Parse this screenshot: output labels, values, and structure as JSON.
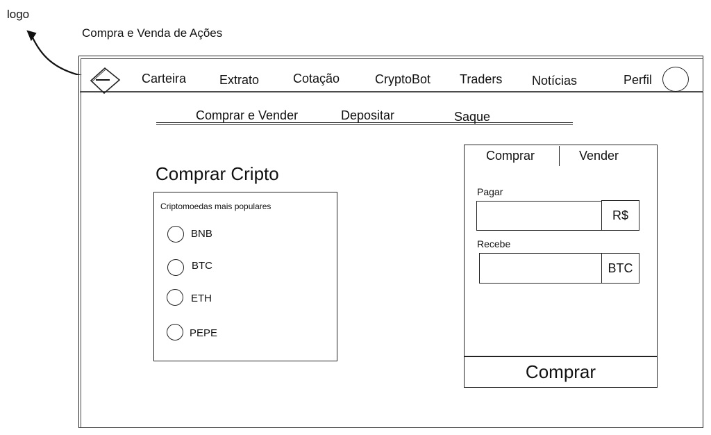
{
  "annotations": {
    "logo_note": "logo",
    "page_title": "Compra e Venda de Ações"
  },
  "navbar": {
    "items": [
      "Carteira",
      "Extrato",
      "Cotação",
      "CryptoBot",
      "Traders",
      "Notícias",
      "Perfil"
    ]
  },
  "subnav": {
    "items": [
      "Comprar e Vender",
      "Depositar",
      "Saque"
    ]
  },
  "main": {
    "title": "Comprar Cripto",
    "list_caption": "Criptomoedas mais populares",
    "cryptos": [
      "BNB",
      "BTC",
      "ETH",
      "PEPE"
    ]
  },
  "trade_panel": {
    "tabs": [
      "Comprar",
      "Vender"
    ],
    "pay_label": "Pagar",
    "pay_value": "",
    "pay_currency": "R$",
    "receive_label": "Recebe",
    "receive_value": "",
    "receive_currency": "BTC",
    "submit_label": "Comprar"
  }
}
